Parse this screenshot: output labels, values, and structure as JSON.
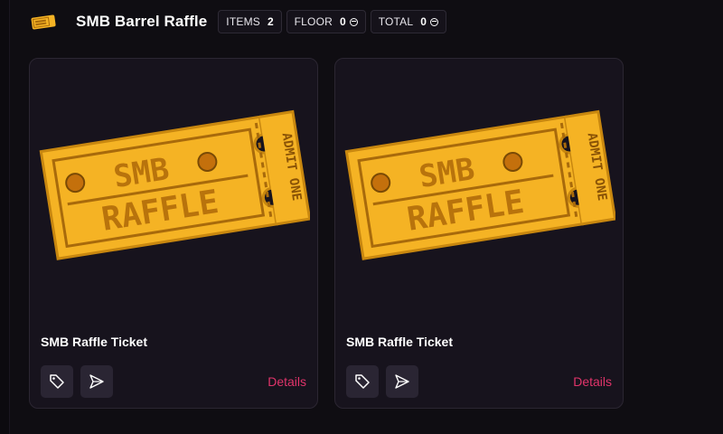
{
  "header": {
    "title": "SMB Barrel Raffle",
    "stats": [
      {
        "label": "ITEMS",
        "value": "2"
      },
      {
        "label": "FLOOR",
        "value": "0"
      },
      {
        "label": "TOTAL",
        "value": "0"
      }
    ]
  },
  "cards": [
    {
      "name": "SMB Raffle Ticket",
      "details_label": "Details",
      "art": {
        "line1": "SMB",
        "line2": "RAFFLE",
        "side": "ADMIT ONE"
      }
    },
    {
      "name": "SMB Raffle Ticket",
      "details_label": "Details",
      "art": {
        "line1": "SMB",
        "line2": "RAFFLE",
        "side": "ADMIT ONE"
      }
    }
  ],
  "colors": {
    "accent": "#e0346a",
    "ticket": "#f5b324",
    "ticket_dark": "#a86a0b",
    "background": "#0f0d12"
  },
  "icons": [
    "ticket-logo-icon",
    "tag-icon",
    "send-icon"
  ]
}
